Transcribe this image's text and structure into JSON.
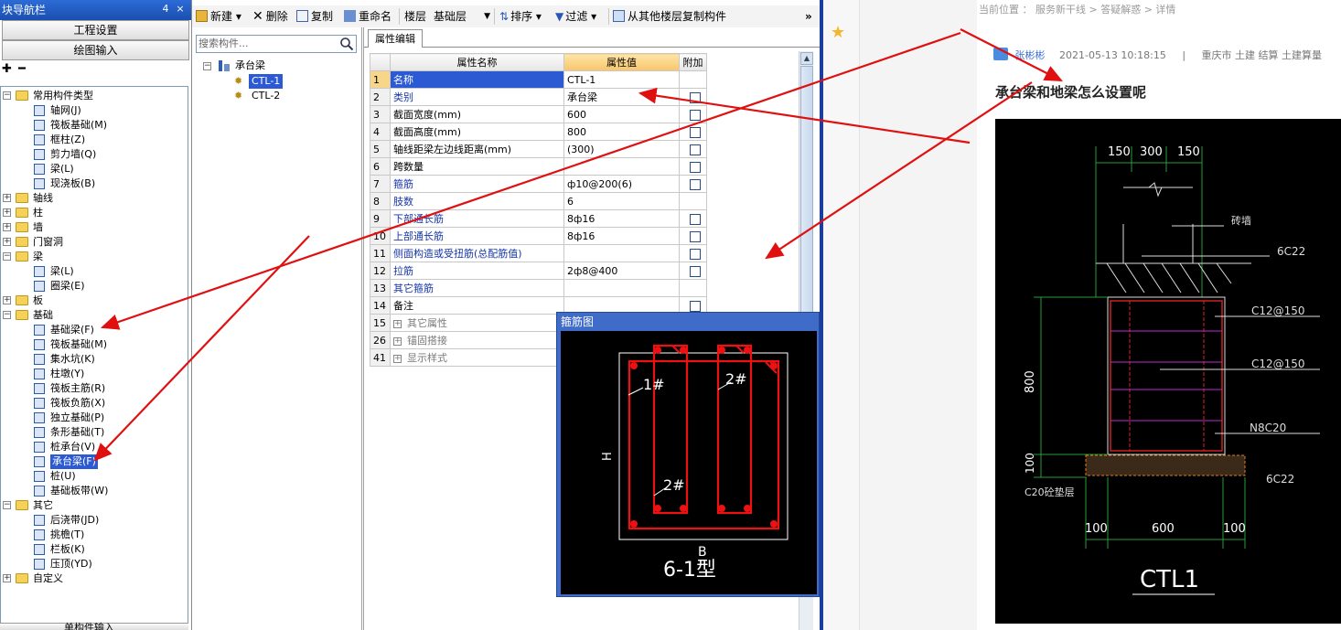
{
  "nav": {
    "title": "块导航栏",
    "pin": "4",
    "close": "×",
    "btn_project": "工程设置",
    "btn_draw": "绘图输入",
    "bottom_label": "单构件输入",
    "tree": [
      {
        "label": "常用构件类型",
        "level": 0,
        "type": "folder",
        "expand": "−"
      },
      {
        "label": "轴网(J)",
        "level": 1,
        "type": "item"
      },
      {
        "label": "筏板基础(M)",
        "level": 1,
        "type": "item"
      },
      {
        "label": "框柱(Z)",
        "level": 1,
        "type": "item"
      },
      {
        "label": "剪力墙(Q)",
        "level": 1,
        "type": "item"
      },
      {
        "label": "梁(L)",
        "level": 1,
        "type": "item"
      },
      {
        "label": "现浇板(B)",
        "level": 1,
        "type": "item"
      },
      {
        "label": "轴线",
        "level": 0,
        "type": "folder",
        "expand": "+"
      },
      {
        "label": "柱",
        "level": 0,
        "type": "folder",
        "expand": "+"
      },
      {
        "label": "墙",
        "level": 0,
        "type": "folder",
        "expand": "+"
      },
      {
        "label": "门窗洞",
        "level": 0,
        "type": "folder",
        "expand": "+"
      },
      {
        "label": "梁",
        "level": 0,
        "type": "folder",
        "expand": "−"
      },
      {
        "label": "梁(L)",
        "level": 1,
        "type": "item"
      },
      {
        "label": "圈梁(E)",
        "level": 1,
        "type": "item"
      },
      {
        "label": "板",
        "level": 0,
        "type": "folder",
        "expand": "+"
      },
      {
        "label": "基础",
        "level": 0,
        "type": "folder",
        "expand": "−"
      },
      {
        "label": "基础梁(F)",
        "level": 1,
        "type": "item"
      },
      {
        "label": "筏板基础(M)",
        "level": 1,
        "type": "item"
      },
      {
        "label": "集水坑(K)",
        "level": 1,
        "type": "item"
      },
      {
        "label": "柱墩(Y)",
        "level": 1,
        "type": "item"
      },
      {
        "label": "筏板主筋(R)",
        "level": 1,
        "type": "item"
      },
      {
        "label": "筏板负筋(X)",
        "level": 1,
        "type": "item"
      },
      {
        "label": "独立基础(P)",
        "level": 1,
        "type": "item"
      },
      {
        "label": "条形基础(T)",
        "level": 1,
        "type": "item"
      },
      {
        "label": "桩承台(V)",
        "level": 1,
        "type": "item"
      },
      {
        "label": "承台梁(F)",
        "level": 1,
        "type": "item",
        "selected": true
      },
      {
        "label": "桩(U)",
        "level": 1,
        "type": "item"
      },
      {
        "label": "基础板带(W)",
        "level": 1,
        "type": "item"
      },
      {
        "label": "其它",
        "level": 0,
        "type": "folder",
        "expand": "−"
      },
      {
        "label": "后浇带(JD)",
        "level": 1,
        "type": "item"
      },
      {
        "label": "挑檐(T)",
        "level": 1,
        "type": "item"
      },
      {
        "label": "栏板(K)",
        "level": 1,
        "type": "item"
      },
      {
        "label": "压顶(YD)",
        "level": 1,
        "type": "item"
      },
      {
        "label": "自定义",
        "level": 0,
        "type": "folder",
        "expand": "+"
      }
    ]
  },
  "toolbar": {
    "new": "新建",
    "delete": "删除",
    "copy": "复制",
    "rename": "重命名",
    "floor_label": "楼层",
    "floor_value": "基础层",
    "sort": "排序",
    "filter": "过滤",
    "copy_from": "从其他楼层复制构件",
    "more": "»"
  },
  "components": {
    "search_placeholder": "搜索构件...",
    "root": "承台梁",
    "items": [
      "CTL-1",
      "CTL-2"
    ]
  },
  "property_editor": {
    "tab": "属性编辑",
    "headers": [
      "属性名称",
      "属性值",
      "附加"
    ],
    "rows": [
      {
        "n": "1",
        "name": "名称",
        "value": "CTL-1",
        "cb": false,
        "style": "blue",
        "selected": true
      },
      {
        "n": "2",
        "name": "类别",
        "value": "承台梁",
        "cb": true,
        "style": "blue"
      },
      {
        "n": "3",
        "name": "截面宽度(mm)",
        "value": "600",
        "cb": true,
        "style": "black"
      },
      {
        "n": "4",
        "name": "截面高度(mm)",
        "value": "800",
        "cb": true,
        "style": "black"
      },
      {
        "n": "5",
        "name": "轴线距梁左边线距离(mm)",
        "value": "(300)",
        "cb": true,
        "style": "black"
      },
      {
        "n": "6",
        "name": "跨数量",
        "value": "",
        "cb": true,
        "style": "black"
      },
      {
        "n": "7",
        "name": "箍筋",
        "value": "ф10@200(6)",
        "cb": true,
        "style": "blue"
      },
      {
        "n": "8",
        "name": "肢数",
        "value": "6",
        "cb": false,
        "style": "blue"
      },
      {
        "n": "9",
        "name": "下部通长筋",
        "value": "8ф16",
        "cb": true,
        "style": "blue"
      },
      {
        "n": "10",
        "name": "上部通长筋",
        "value": "8ф16",
        "cb": true,
        "style": "blue"
      },
      {
        "n": "11",
        "name": "侧面构造或受扭筋(总配筋值)",
        "value": "",
        "cb": true,
        "style": "blue"
      },
      {
        "n": "12",
        "name": "拉筋",
        "value": "2ф8@400",
        "cb": true,
        "style": "blue"
      },
      {
        "n": "13",
        "name": "其它箍筋",
        "value": "",
        "cb": false,
        "style": "blue"
      },
      {
        "n": "14",
        "name": "备注",
        "value": "",
        "cb": true,
        "style": "black"
      },
      {
        "n": "15",
        "name": "其它属性",
        "value": "",
        "cb": false,
        "style": "grey",
        "group": true
      },
      {
        "n": "26",
        "name": "锚固搭接",
        "value": "",
        "cb": false,
        "style": "grey",
        "group": true
      },
      {
        "n": "41",
        "name": "显示样式",
        "value": "",
        "cb": false,
        "style": "grey",
        "group": true
      }
    ]
  },
  "stirrup_dialog": {
    "title": "箍筋图",
    "label_1": "1#",
    "label_2a": "2#",
    "label_2b": "2#",
    "label_h": "H",
    "label_b": "B",
    "type_label": "6-1型"
  },
  "webpage": {
    "breadcrumb": "当前位置 ： 服务新干线 > 答疑解惑 > 详情",
    "author": "张彬彬",
    "datetime": "2021-05-13 10:18:15",
    "divider": "|",
    "tags": "重庆市 土建 结算 土建算量",
    "question": "承台梁和地梁怎么设置呢",
    "drawing": {
      "dim_top": [
        "150",
        "300",
        "150"
      ],
      "dim_bottom": [
        "100",
        "600",
        "100"
      ],
      "dim_left_800": "800",
      "dim_left_100": "100",
      "label_wall": "砖墙",
      "label_6c22_top": "6C22",
      "label_c12_1": "C12@150",
      "label_c12_2": "C12@150",
      "label_n8c20": "N8C20",
      "label_6c22_bot": "6C22",
      "label_cushion": "C20砼垫层",
      "title": "CTL1"
    }
  },
  "colors": {
    "selection": "#2b5ad2",
    "header_highlight": "#f7c56c",
    "annotation_arrow": "#e01010",
    "cad_background": "#000000"
  }
}
